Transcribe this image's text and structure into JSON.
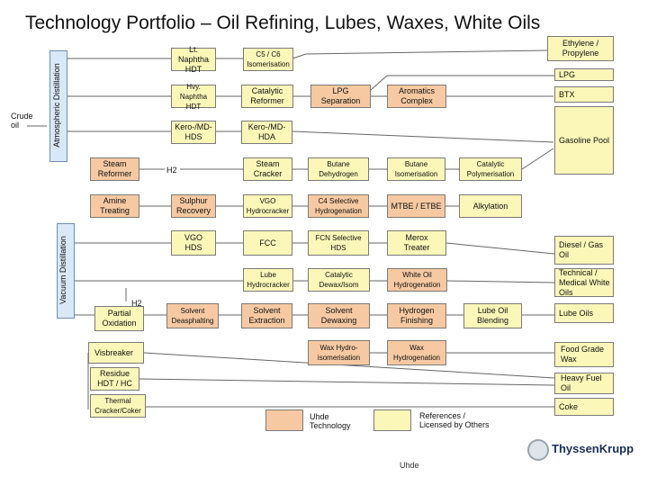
{
  "title": "Technology Portfolio – Oil Refining, Lubes, Waxes, White Oils",
  "feed": "Crude\noil",
  "columns": {
    "atmospheric": "Atmospheric Distillation",
    "vacuum": "Vacuum Distillation"
  },
  "units": {
    "lt_naphtha_hdt": "Lt. Naphtha\nHDT",
    "c5c6_isom": "C5 / C6\nIsomerisation",
    "hvy_naphtha_hdt": "Hvy. Naphtha\nHDT",
    "catalytic_reformer": "Catalytic\nReformer",
    "lpg_separation": "LPG\nSeparation",
    "aromatics_complex": "Aromatics\nComplex",
    "kero_mds": "Kero-/MD-\nHDS",
    "kero_mda": "Kero-/MD-\nHDA",
    "steam_reformer": "Steam\nReformer",
    "h2_label": "H2",
    "steam_cracker": "Steam\nCracker",
    "butane_dehydrogen": "Butane\nDehydrogen",
    "butane_isom": "Butane\nIsomerisation",
    "catalytic_polymerisation": "Catalytic\nPolymerisation",
    "amine_treating": "Amine\nTreating",
    "sulphur_recovery": "Sulphur\nRecovery",
    "vgo_hydrocracker": "VGO\nHydrocracker",
    "c4_selective_hydrogenation": "C4 Selective\nHydrogenation",
    "mtbe_etbe": "MTBE / ETBE",
    "alkylation": "Alkylation",
    "vgo_hds": "VGO\nHDS",
    "fcc": "FCC",
    "fcn_selective_hds": "FCN Selective\nHDS",
    "merox_treater": "Merox\nTreater",
    "lube_hydrocracker": "Lube\nHydrocracker",
    "catalytic_dewax": "Catalytic\nDewax/Isom",
    "white_oil_hydrogenation": "White Oil\nHydrogenation",
    "h2_partial_label": "H2",
    "partial_oxidation": "Partial\nOxidation",
    "solvent_deasphalting": "Solvent\nDeasphalting",
    "solvent_extraction": "Solvent\nExtraction",
    "solvent_dewaxing": "Solvent\nDewaxing",
    "hydrogen_finishing": "Hydrogen\nFinishing",
    "lube_oil_blending": "Lube Oil\nBlending",
    "visbreaker": "Visbreaker",
    "wax_hydroisom": "Wax Hydro-\nisomerisation",
    "wax_hydrogenation": "Wax\nHydrogenation",
    "residue_hdt_hc": "Residue\nHDT / HC",
    "thermal_cracker_coker": "Thermal\nCracker/Coker"
  },
  "products": {
    "ethylene_propylene": "Ethylene /\nPropylene",
    "lpg": "LPG",
    "btx": "BTX",
    "gasoline_pool": "Gasoline Pool",
    "diesel_gas_oil": "Diesel / Gas\nOil",
    "technical_white_oils": "Technical /\nMedical White\nOils",
    "lube_oils": "Lube Oils",
    "food_grade_wax": "Food Grade\nWax",
    "heavy_fuel_oil": "Heavy Fuel\nOil",
    "coke": "Coke"
  },
  "legend": {
    "uhde_label": "Uhde\nTechnology",
    "licensed_label": "References /\nLicensed by Others"
  },
  "colors": {
    "uhde": "#f6c9a2",
    "licensed": "#fbf7b8",
    "distillation": "#d9e8f7"
  },
  "footer": {
    "logo": "ThyssenKrupp",
    "company": "Uhde"
  }
}
